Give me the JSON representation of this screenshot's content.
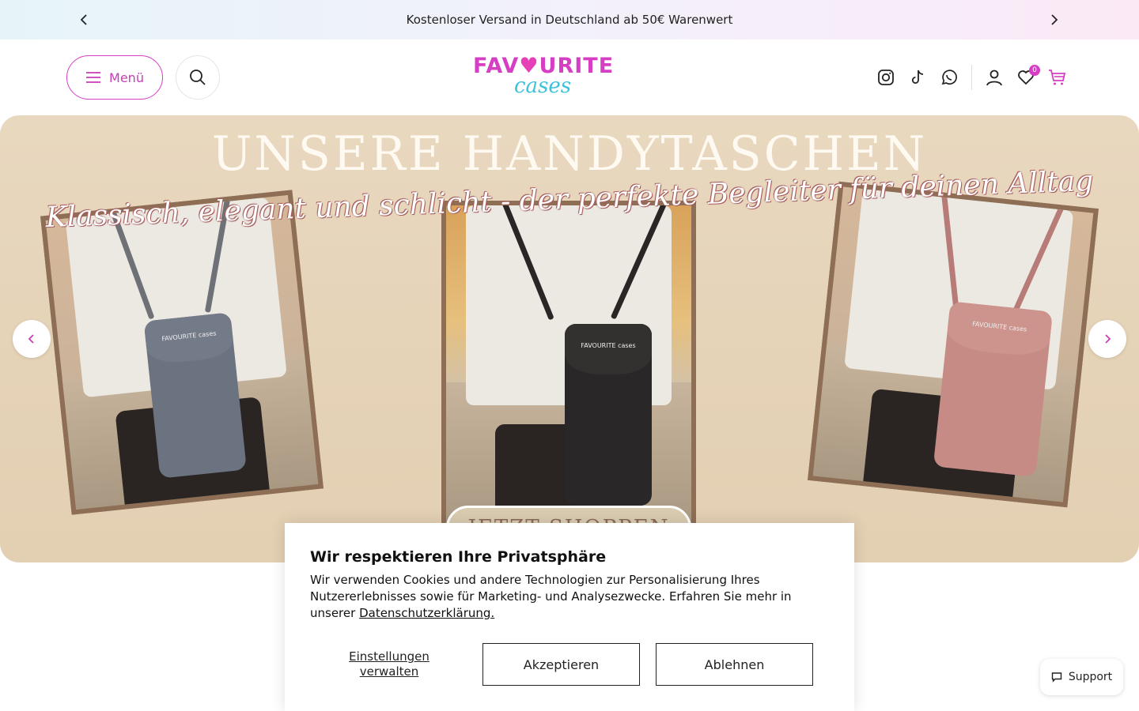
{
  "announcement": {
    "text": "Kostenloser Versand in Deutschland ab 50€ Warenwert",
    "prev_icon": "chevron-left-icon",
    "next_icon": "chevron-right-icon"
  },
  "header": {
    "menu_label": "Menü",
    "logo_top": "FAV",
    "logo_heart": "♥",
    "logo_top_rest": "URITE",
    "logo_bottom": "cases",
    "cart_badge": "0",
    "brand_color": "#d63fc3",
    "icons": [
      "instagram-icon",
      "tiktok-icon",
      "whatsapp-icon",
      "account-icon",
      "wishlist-icon",
      "cart-icon"
    ]
  },
  "hero": {
    "title": "UNSERE HANDYTASCHEN",
    "subtitle": "Klassisch, elegant und schlicht - der perfekte Begleiter für deinen Alltag",
    "bag_brand": "FAVOURITE cases",
    "cta": "JETZT SHOPPEN"
  },
  "cookie": {
    "title": "Wir respektieren Ihre Privatsphäre",
    "text": "Wir verwenden Cookies und andere Technologien zur Personalisierung Ihres Nutzererlebnisses sowie für Marketing- und Analysezwecke. Erfahren Sie mehr in unserer",
    "link": "Datenschutzerklärung.",
    "manage": "Einstellungen verwalten",
    "accept": "Akzeptieren",
    "decline": "Ablehnen"
  },
  "support": {
    "label": "Support"
  }
}
